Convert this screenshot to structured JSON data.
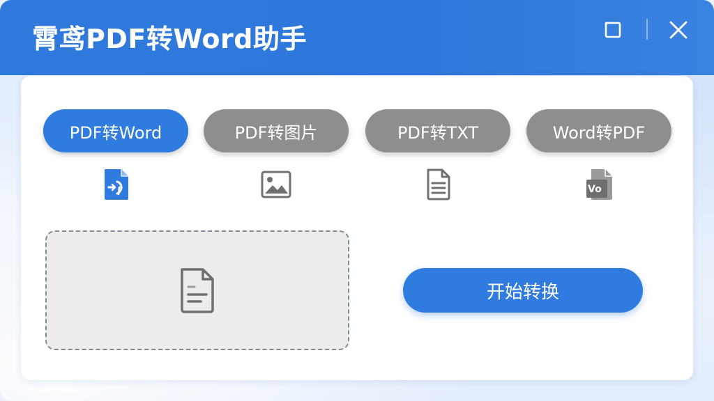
{
  "window": {
    "title": "霄鸢PDF转Word助手"
  },
  "titlebar": {
    "maximize_icon": "maximize-icon",
    "close_icon": "close-icon"
  },
  "tabs": [
    {
      "label": "PDF转Word",
      "active": true,
      "icon": "pdf-to-word-icon"
    },
    {
      "label": "PDF转图片",
      "active": false,
      "icon": "image-icon"
    },
    {
      "label": "PDF转TXT",
      "active": false,
      "icon": "text-document-icon"
    },
    {
      "label": "Word转PDF",
      "active": false,
      "icon": "word-document-icon"
    }
  ],
  "tab_icon_word_text": "Vo",
  "dropzone": {
    "icon": "file-icon"
  },
  "actions": {
    "start_label": "开始转换"
  },
  "colors": {
    "accent": "#2f7be0",
    "titlebar": "#2f78db",
    "inactive_tab": "#8e8e8e",
    "dropzone_bg": "#ececec"
  }
}
